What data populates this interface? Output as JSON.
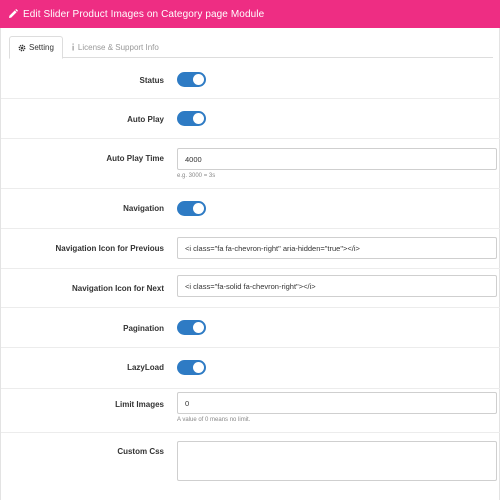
{
  "header": {
    "title": "Edit Slider Product Images on Category page Module",
    "icon": "pencil-icon",
    "color": "#ee2d83"
  },
  "tabs": [
    {
      "label": "Setting",
      "icon": "gear-icon",
      "active": true
    },
    {
      "label": "License & Support Info",
      "icon": "info-icon",
      "active": false
    }
  ],
  "form": {
    "status": {
      "label": "Status",
      "enabled": true
    },
    "autoplay": {
      "label": "Auto Play",
      "enabled": true
    },
    "autoplay_time": {
      "label": "Auto Play Time",
      "value": "4000",
      "help": "e.g. 3000 = 3s"
    },
    "navigation": {
      "label": "Navigation",
      "enabled": true
    },
    "nav_prev": {
      "label": "Navigation Icon for Previous",
      "value": "<i class=\"fa fa-chevron-right\" aria-hidden=\"true\"></i>"
    },
    "nav_next": {
      "label": "Navigation Icon for Next",
      "value": "<i class=\"fa-solid fa-chevron-right\"></i>"
    },
    "pagination": {
      "label": "Pagination",
      "enabled": true
    },
    "lazyload": {
      "label": "LazyLoad",
      "enabled": true
    },
    "limit_images": {
      "label": "Limit Images",
      "value": "0",
      "help": "A value of 0 means no limit."
    },
    "custom_css": {
      "label": "Custom Css",
      "value": ""
    }
  },
  "colors": {
    "toggle_on": "#2e7bc4",
    "accent": "#ee2d83"
  }
}
